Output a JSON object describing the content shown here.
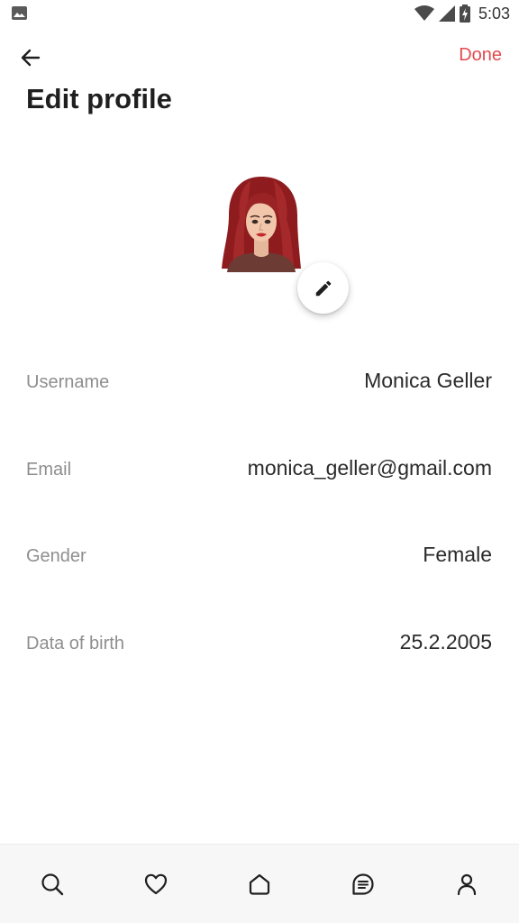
{
  "status_bar": {
    "time": "5:03",
    "icons": [
      "image-notification-icon",
      "wifi-icon",
      "cellular-signal-icon",
      "battery-charging-icon"
    ]
  },
  "app_bar": {
    "back_icon": "arrow-left-icon",
    "done_label": "Done"
  },
  "title": "Edit profile",
  "avatar": {
    "edit_icon": "pencil-icon"
  },
  "fields": [
    {
      "label": "Username",
      "value": "Monica Geller"
    },
    {
      "label": "Email",
      "value": "monica_geller@gmail.com"
    },
    {
      "label": "Gender",
      "value": "Female"
    },
    {
      "label": "Data of birth",
      "value": "25.2.2005"
    }
  ],
  "bottom_nav": {
    "items": [
      "search-icon",
      "heart-icon",
      "home-icon",
      "chat-icon",
      "profile-icon"
    ]
  },
  "colors": {
    "accent": "#e34a4f",
    "label": "#8e8e8e",
    "text": "#1f1f1f",
    "nav_background": "#f7f7f7"
  }
}
